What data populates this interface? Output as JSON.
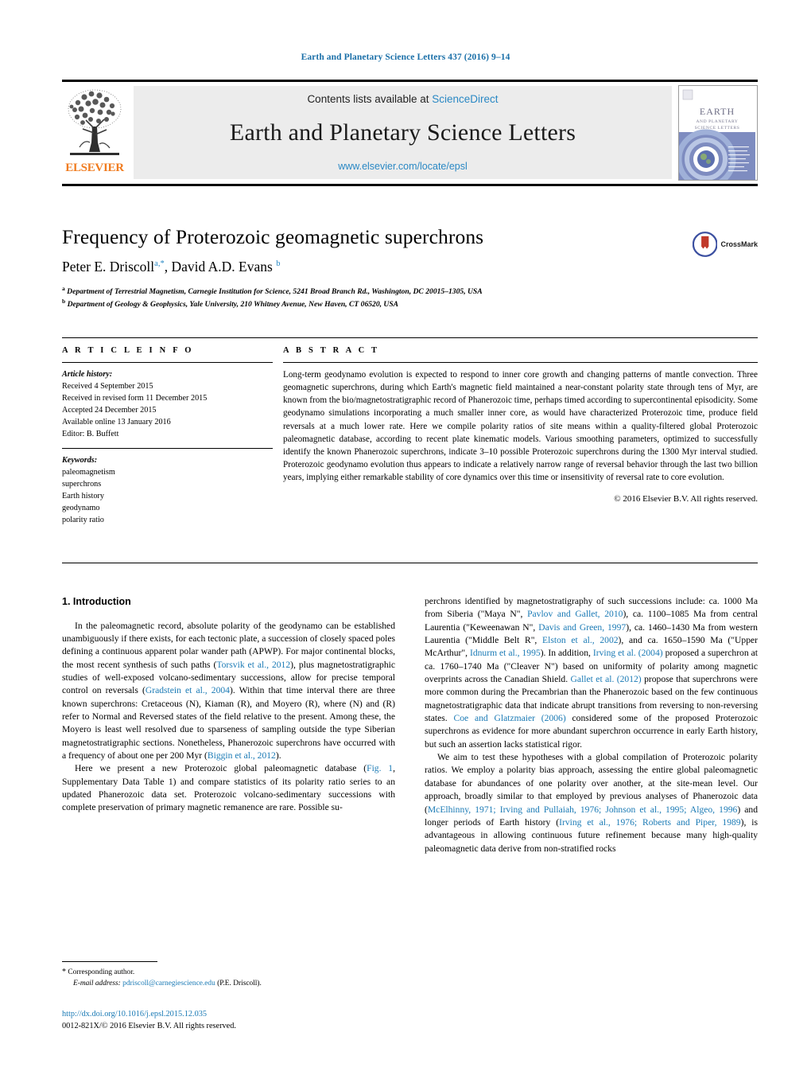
{
  "running_head": "Earth and Planetary Science Letters 437 (2016) 9–14",
  "masthead": {
    "publisher": "ELSEVIER",
    "contents_prefix": "Contents lists available at ",
    "contents_link": "ScienceDirect",
    "journal_title": "Earth and Planetary Science Letters",
    "journal_url": "www.elsevier.com/locate/epsl",
    "cover_title_line1": "EARTH",
    "cover_title_line2": "AND PLANETARY",
    "cover_title_line3": "SCIENCE LETTERS"
  },
  "article": {
    "title": "Frequency of Proterozoic geomagnetic superchrons",
    "authors_html": "Peter E. Driscoll <sup>a,*</sup>, David A.D. Evans <sup>b</sup>",
    "author_1": "Peter E. Driscoll",
    "author_2": "David A.D. Evans",
    "affiliation_a": "Department of Terrestrial Magnetism, Carnegie Institution for Science, 5241 Broad Branch Rd., Washington, DC 20015–1305, USA",
    "affiliation_b": "Department of Geology & Geophysics, Yale University, 210 Whitney Avenue, New Haven, CT 06520, USA",
    "crossmark_label": "CrossMark"
  },
  "article_info": {
    "heading": "A R T I C L E   I N F O",
    "history_heading": "Article history:",
    "history": [
      "Received 4 September 2015",
      "Received in revised form 11 December 2015",
      "Accepted 24 December 2015",
      "Available online 13 January 2016",
      "Editor: B. Buffett"
    ],
    "keywords_heading": "Keywords:",
    "keywords": [
      "paleomagnetism",
      "superchrons",
      "Earth history",
      "geodynamo",
      "polarity ratio"
    ]
  },
  "abstract": {
    "heading": "A B S T R A C T",
    "text": "Long-term geodynamo evolution is expected to respond to inner core growth and changing patterns of mantle convection. Three geomagnetic superchrons, during which Earth's magnetic field maintained a near-constant polarity state through tens of Myr, are known from the bio/magnetostratigraphic record of Phanerozoic time, perhaps timed according to supercontinental episodicity. Some geodynamo simulations incorporating a much smaller inner core, as would have characterized Proterozoic time, produce field reversals at a much lower rate. Here we compile polarity ratios of site means within a quality-filtered global Proterozoic paleomagnetic database, according to recent plate kinematic models. Various smoothing parameters, optimized to successfully identify the known Phanerozoic superchrons, indicate 3–10 possible Proterozoic superchrons during the 1300 Myr interval studied. Proterozoic geodynamo evolution thus appears to indicate a relatively narrow range of reversal behavior through the last two billion years, implying either remarkable stability of core dynamics over this time or insensitivity of reversal rate to core evolution.",
    "copyright": "© 2016 Elsevier B.V. All rights reserved."
  },
  "body": {
    "section_heading": "1. Introduction",
    "left_para_1_pre": "In the paleomagnetic record, absolute polarity of the geodynamo can be established unambiguously if there exists, for each tectonic plate, a succession of closely spaced poles defining a continuous apparent polar wander path (APWP). For major continental blocks, the most recent synthesis of such paths (",
    "ref_torsvik": "Torsvik et al., 2012",
    "left_para_1_mid": "), plus magnetostratigraphic studies of well-exposed volcano-sedimentary successions, allow for precise temporal control on reversals (",
    "ref_gradstein": "Gradstein et al., 2004",
    "left_para_1_post": "). Within that time interval there are three known superchrons: Cretaceous (N), Kiaman (R), and Moyero (R), where (N) and (R) refer to Normal and Reversed states of the field relative to the present. Among these, the Moyero is least well resolved due to sparseness of sampling outside the type Siberian magnetostratigraphic sections. Nonetheless, Phanerozoic superchrons have occurred with a frequency of about one per 200 Myr (",
    "ref_biggin": "Biggin et al., 2012",
    "left_para_1_end": ").",
    "left_para_2_pre": "Here we present a new Proterozoic global paleomagnetic database (",
    "ref_fig1": "Fig. 1",
    "left_para_2_post": ", Supplementary Data Table 1) and compare statistics of its polarity ratio series to an updated Phanerozoic data set. Proterozoic volcano-sedimentary successions with complete preservation of primary magnetic remanence are rare. Possible su-",
    "right_para_1_pre": "perchrons identified by magnetostratigraphy of such successions include: ca. 1000 Ma from Siberia (\"Maya N\", ",
    "ref_pavlov": "Pavlov and Gallet, 2010",
    "right_1_a": "), ca. 1100–1085 Ma from central Laurentia (\"Keweenawan N\", ",
    "ref_davis": "Davis and Green, 1997",
    "right_1_b": "), ca. 1460–1430 Ma from western Laurentia (\"Middle Belt R\", ",
    "ref_elston": "Elston et al., 2002",
    "right_1_c": "), and ca. 1650–1590 Ma (\"Upper McArthur\", ",
    "ref_idnurm": "Idnurm et al., 1995",
    "right_1_d": "). In addition, ",
    "ref_irving2004": "Irving et al. (2004)",
    "right_1_e": " proposed a superchron at ca. 1760–1740 Ma (\"Cleaver N\") based on uniformity of polarity among magnetic overprints across the Canadian Shield. ",
    "ref_gallet": "Gallet et al. (2012)",
    "right_1_f": " propose that superchrons were more common during the Precambrian than the Phanerozoic based on the few continuous magnetostratigraphic data that indicate abrupt transitions from reversing to non-reversing states. ",
    "ref_coe": "Coe and Glatzmaier (2006)",
    "right_1_g": " considered some of the proposed Proterozoic superchrons as evidence for more abundant superchron occurrence in early Earth history, but such an assertion lacks statistical rigor.",
    "right_para_2_pre": "We aim to test these hypotheses with a global compilation of Proterozoic polarity ratios. We employ a polarity bias approach, assessing the entire global paleomagnetic database for abundances of one polarity over another, at the site-mean level. Our approach, broadly similar to that employed by previous analyses of Phanerozoic data (",
    "ref_mcelhinny": "McElhinny, 1971; Irving and Pullaiah, 1976; Johnson et al., 1995; Algeo, 1996",
    "right_2_a": ") and longer periods of Earth history (",
    "ref_irving1976": "Irving et al., 1976; Roberts and Piper, 1989",
    "right_2_b": "), is advantageous in allowing continuous future refinement because many high-quality paleomagnetic data derive from non-stratified rocks"
  },
  "footnote": {
    "star": "*",
    "corresponding": "Corresponding author.",
    "email_label": "E-mail address:",
    "email": "pdriscoll@carnegiescience.edu",
    "email_suffix": "(P.E. Driscoll)."
  },
  "doi": {
    "link": "http://dx.doi.org/10.1016/j.epsl.2015.12.035",
    "issn_copyright": "0012-821X/© 2016 Elsevier B.V. All rights reserved."
  },
  "colors": {
    "link_blue": "#1a7ab5",
    "header_blue": "#1a6fa8",
    "elsevier_orange": "#F07C20",
    "masthead_gray": "#ececec"
  }
}
